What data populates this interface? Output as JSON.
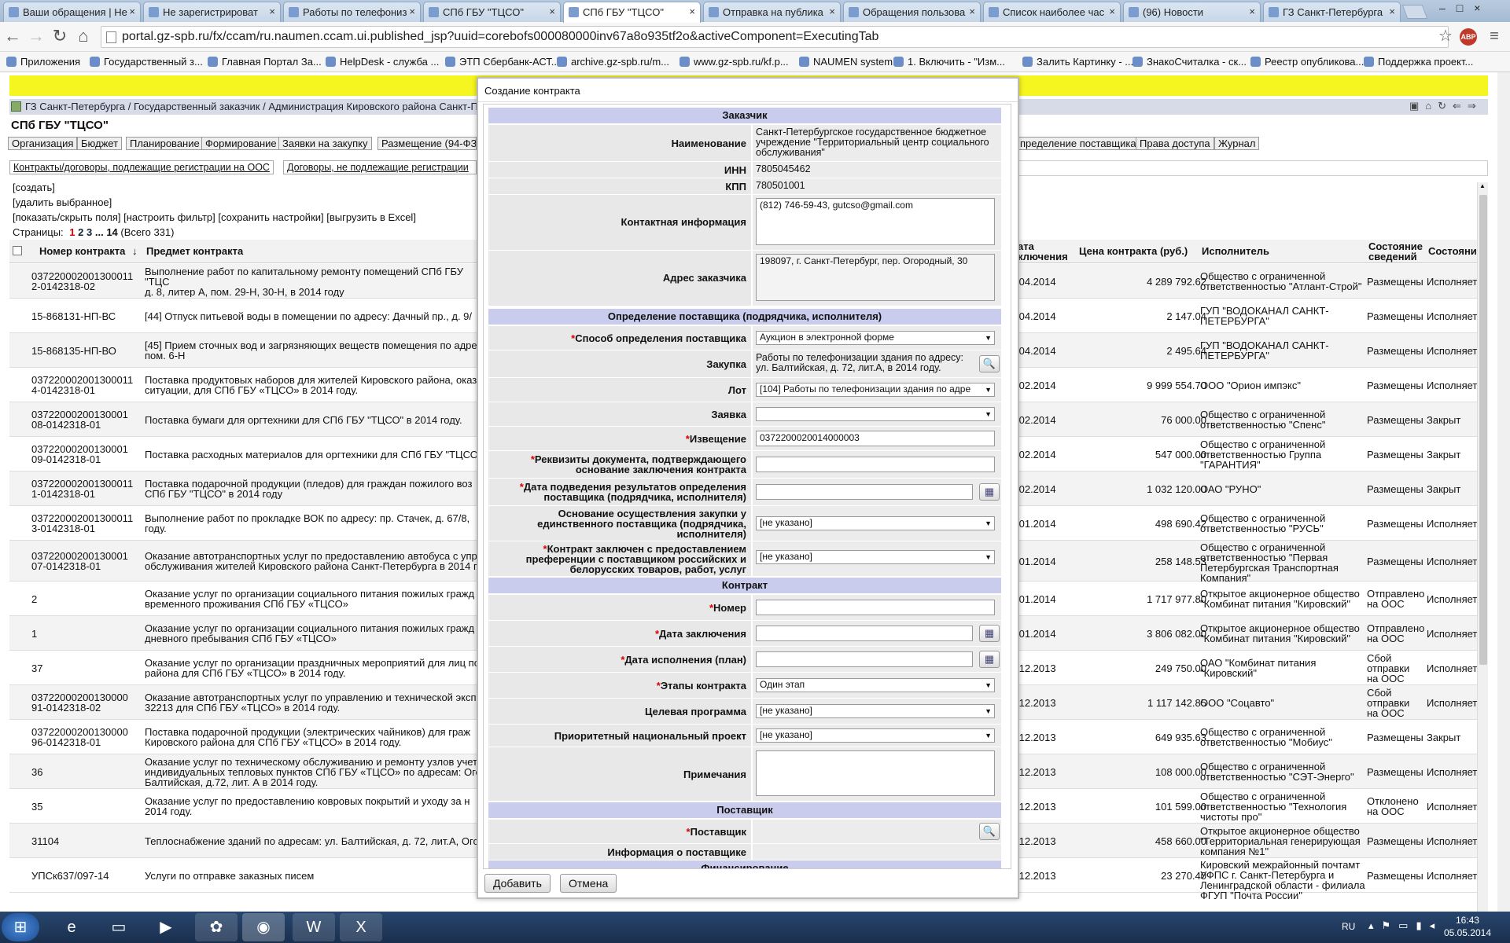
{
  "browser": {
    "tabs": [
      {
        "label": "Ваши обращения | Не"
      },
      {
        "label": "Не зарегистрироват"
      },
      {
        "label": "Работы по телефониз"
      },
      {
        "label": "СПб ГБУ \"ТЦСО\""
      },
      {
        "label": "СПб ГБУ \"ТЦСО\"",
        "active": true
      },
      {
        "label": "Отправка на публика"
      },
      {
        "label": "Обращения пользова"
      },
      {
        "label": "Список наиболее час"
      },
      {
        "label": "(96) Новости"
      },
      {
        "label": "ГЗ Санкт-Петербурга"
      }
    ],
    "url": "portal.gz-spb.ru/fx/ccam/ru.naumen.ccam.ui.published_jsp?uuid=corebofs000080000inv67a8o935tf2o&activeComponent=ExecutingTab",
    "ext_badge": "ABP",
    "bookmarks": [
      "Приложения",
      "Государственный з...",
      "Главная Портал За...",
      "HelpDesk - служба ...",
      "ЭТП Сбербанк-АСТ...",
      "archive.gz-spb.ru/m...",
      "www.gz-spb.ru/kf.p...",
      "NAUMEN system",
      "1. Включить - \"Изм...",
      "Залить Картинку - ...",
      "ЗнакоСчиталка - ск...",
      "Реестр опубликова...",
      "Поддержка проект..."
    ]
  },
  "page": {
    "breadcrumb": "ГЗ Санкт-Петербурга / Государственный заказчик / Администрация Кировского района Санкт-Пет",
    "org_title": "СПб ГБУ \"ТЦСО\"",
    "main_tabs": [
      "Организация",
      "Бюджет",
      "Планирование",
      "Формирование",
      "Заявки на закупку",
      "Размещение (94-ФЗ"
    ],
    "main_tabs_right": [
      "пределение поставщика",
      "Права доступа",
      "Журнал"
    ],
    "sub_tabs": [
      "Контракты/договоры, подлежащие регистрации на ООС",
      "Договоры, не подлежащие регистрации"
    ],
    "actions": {
      "create": "[создать]",
      "delete": "[удалить выбранное]",
      "show_hide": "[показать/скрыть поля]",
      "filter": "[настроить фильтр]",
      "save": "[сохранить настройки]",
      "export": "[выгрузить в Excel]"
    },
    "pager": {
      "label": "Страницы:",
      "current": "1",
      "p2": "2",
      "p3": "3",
      "dots": "...",
      "last": "14",
      "total": "(Всего 331)"
    },
    "columns": {
      "number": "Номер контракта",
      "subject": "Предмет контракта",
      "date": "ата\nключения",
      "price": "Цена контракта (руб.)",
      "executor": "Исполнитель",
      "info_state": "Состояние\nсведений",
      "state": "Состояние"
    },
    "rows": [
      {
        "number": "0372200020013000112-0142318-02",
        "subject": "Выполнение работ по капитальному ремонту помещений СПб ГБУ \"ТЦС\nд. 8, литер А, пом. 29-Н, 30-Н, в 2014 году",
        "date": ".04.2014",
        "price": "4 289 792.62",
        "executor": "Общество с ограниченной\nответственностью \"Атлант-Строй\"",
        "info": "Размещены",
        "state": "Исполняется"
      },
      {
        "number": "15-868131-НП-ВС",
        "subject": "[44] Отпуск питьевой воды в помещении по адресу: Дачный пр., д. 9/",
        "date": ".04.2014",
        "price": "2 147.04",
        "executor": "ГУП \"ВОДОКАНАЛ САНКТ-\nПЕТЕРБУРГА\"",
        "info": "Размещены",
        "state": "Исполняется"
      },
      {
        "number": "15-868135-НП-ВО",
        "subject": "[45] Прием сточных вод и загрязняющих веществ помещения по адре\nпом. 6-Н",
        "date": ".04.2014",
        "price": "2 495.64",
        "executor": "ГУП \"ВОДОКАНАЛ САНКТ-\nПЕТЕРБУРГА\"",
        "info": "Размещены",
        "state": "Исполняется"
      },
      {
        "number": "0372200020013000114-0142318-01",
        "subject": "Поставка продуктовых наборов для жителей Кировского района, оказ\nситуации, для СПб ГБУ «ТЦСО» в 2014 году.",
        "date": ".02.2014",
        "price": "9 999 554.70",
        "executor": "ООО \"Орион импэкс\"",
        "info": "Размещены",
        "state": "Исполняется"
      },
      {
        "number": "0372200020013000108-0142318-01",
        "subject": "Поставка бумаги для оргтехники для СПб ГБУ \"ТЦСО\" в 2014 году.",
        "date": ".02.2014",
        "price": "76 000.00",
        "executor": "Общество с ограниченной\nответственностью \"Спенс\"",
        "info": "Размещены",
        "state": "Закрыт"
      },
      {
        "number": "0372200020013000109-0142318-01",
        "subject": "Поставка расходных материалов для оргтехники для СПб ГБУ \"ТЦСО\"",
        "date": ".02.2014",
        "price": "547 000.00",
        "executor": "Общество с ограниченной\nответственностью Группа\n\"ГАРАНТИЯ\"",
        "info": "Размещены",
        "state": "Закрыт"
      },
      {
        "number": "0372200020013000111-0142318-01",
        "subject": "Поставка подарочной продукции (пледов) для граждан пожилого воз\nСПб ГБУ \"ТЦСО\" в 2014 году",
        "date": ".02.2014",
        "price": "1 032 120.00",
        "executor": "ОАО \"РУНО\"",
        "info": "Размещены",
        "state": "Закрыт"
      },
      {
        "number": "0372200020013000113-0142318-01",
        "subject": "Выполнение работ по прокладке ВОК по адресу: пр. Стачек, д. 67/8,\nгоду.",
        "date": ".01.2014",
        "price": "498 690.42",
        "executor": "Общество с ограниченной\nответственностью \"РУСЬ\"",
        "info": "Размещены",
        "state": "Исполняется"
      },
      {
        "number": "0372200020013000107-0142318-01",
        "subject": "Оказание автотранспортных услуг по предоставлению автобуса с упр\nобслуживания жителей Кировского района Санкт-Петербурга в 2014 г",
        "date": ".01.2014",
        "price": "258 148.53",
        "executor": "Общество с ограниченной\nответственностью \"Первая\nПетербургская Транспортная\nКомпания\"",
        "info": "Размещены",
        "state": "Исполняется"
      },
      {
        "number": "2",
        "subject": "Оказание услуг по организации социального питания пожилых гражд\nвременного проживания СПб ГБУ «ТЦСО»",
        "date": ".01.2014",
        "price": "1 717 977.80",
        "executor": "Открытое акционерное общество\n\"Комбинат питания \"Кировский\"",
        "info": "Отправлено\nна ООС",
        "state": "Исполняется"
      },
      {
        "number": "1",
        "subject": "Оказание услуг по организации социального питания пожилых гражд\nдневного пребывания СПб ГБУ «ТЦСО»",
        "date": ".01.2014",
        "price": "3 806 082.00",
        "executor": "Открытое акционерное общество\n\"Комбинат питания \"Кировский\"",
        "info": "Отправлено\nна ООС",
        "state": "Исполняется"
      },
      {
        "number": "37",
        "subject": "Оказание услуг по организации праздничных мероприятий для лиц по\nрайона для СПб ГБУ «ТЦСО» в 2014 году.",
        "date": ".12.2013",
        "price": "249 750.00",
        "executor": "ОАО \"Комбинат питания\n\"Кировский\"",
        "info": "Сбой\nотправки\nна ООС",
        "state": "Исполняется"
      },
      {
        "number": "0372200020013000091-0142318-02",
        "subject": "Оказание автотранспортных услуг по управлению и технической эксп\n32213 для СПб ГБУ «ТЦСО» в 2014 году.",
        "date": ".12.2013",
        "price": "1 117 142.85",
        "executor": "ООО \"Соцавто\"",
        "info": "Сбой\nотправки\nна ООС",
        "state": "Исполняется"
      },
      {
        "number": "0372200020013000096-0142318-01",
        "subject": "Поставка подарочной продукции (электрических чайников) для граж\nКировского района для СПб ГБУ «ТЦСО» в 2014 году.",
        "date": ".12.2013",
        "price": "649 935.63",
        "executor": "Общество с ограниченной\nответственностью \"Мобиус\"",
        "info": "Размещены",
        "state": "Закрыт"
      },
      {
        "number": "36",
        "subject": "Оказание услуг по техническому обслуживанию и ремонту узлов учет\nиндивидуальных тепловых пунктов СПб ГБУ «ТЦСО» по адресам: Ого\nБалтийская, д.72, лит. А в 2014 году.",
        "date": ".12.2013",
        "price": "108 000.00",
        "executor": "Общество с ограниченной\nответственностью \"СЭТ-Энерго\"",
        "info": "Размещены",
        "state": "Исполняется"
      },
      {
        "number": "35",
        "subject": "Оказание услуг по предоставлению ковровых покрытий и уходу за н\n2014 году.",
        "date": ".12.2013",
        "price": "101 599.00",
        "executor": "Общество с ограниченной\nответственностью \"Технология\nчистоты про\"",
        "info": "Отклонено\nна ООС",
        "state": "Исполняется"
      },
      {
        "number": "31104",
        "subject": "Теплоснабжение зданий по адресам: ул. Балтийская, д. 72, лит.А, Ого",
        "date": ".12.2013",
        "price": "458 660.00",
        "executor": "Открытое акционерное общество\n\"Территориальная генерирующая\nкомпания №1\"",
        "info": "Размещены",
        "state": "Исполняется"
      },
      {
        "number": "УПСк637/097-14",
        "subject": "Услуги по отправке заказных писем",
        "date": ".12.2013",
        "price": "23 270.40",
        "executor": "Кировский межрайонный почтамт\nУФПС г. Санкт-Петербурга и\nЛенинградской области - филиала\nФГУП \"Почта России\"",
        "info": "Размещены",
        "state": "Исполняется"
      }
    ]
  },
  "modal": {
    "title": "Создание контракта",
    "sec_customer": "Заказчик",
    "f_name_label": "Наименование",
    "f_name_value": "Санкт-Петербургское государственное бюджетное учреждение \"Территориальный центр социального обслуживания\"",
    "f_inn_label": "ИНН",
    "f_inn_value": "7805045462",
    "f_kpp_label": "КПП",
    "f_kpp_value": "780501001",
    "f_contact_label": "Контактная информация",
    "f_contact_value": "(812) 746-59-43, gutcso@gmail.com",
    "f_address_label": "Адрес заказчика",
    "f_address_value": "198097, г. Санкт-Петербург, пер. Огородный, 30",
    "sec_supplier_def": "Определение поставщика (подрядчика, исполнителя)",
    "f_method_label": "Способ определения поставщика",
    "f_method_value": "Аукцион в электронной форме",
    "f_purchase_label": "Закупка",
    "f_purchase_value": "Работы по телефонизации здания по адресу: ул. Балтийская, д. 72, лит.А, в 2014 году.",
    "f_lot_label": "Лот",
    "f_lot_value": "[104] Работы по телефонизации здания по адре",
    "f_bid_label": "Заявка",
    "f_bid_value": "",
    "f_notice_label": "Извещение",
    "f_notice_value": "0372200020014000003",
    "f_doc_label": "Реквизиты документа, подтверждающего основание заключения контракта",
    "f_doc_value": "",
    "f_resdate_label": "Дата подведения результатов определения поставщика (подрядчика, исполнителя)",
    "f_resdate_value": "",
    "f_single_label": "Основание осуществления закупки у единственного поставщика (подрядчика, исполнителя)",
    "f_single_value": "[не указано]",
    "f_pref_label": "Контракт заключен с предоставлением преференции с поставщиком российских и белорусских товаров, работ, услуг",
    "f_pref_value": "[не указано]",
    "sec_contract": "Контракт",
    "f_number_label": "Номер",
    "f_number_value": "",
    "f_concl_label": "Дата заключения",
    "f_concl_value": "",
    "f_exec_label": "Дата исполнения (план)",
    "f_exec_value": "",
    "f_stages_label": "Этапы контракта",
    "f_stages_value": "Один этап",
    "f_program_label": "Целевая программа",
    "f_program_value": "[не указано]",
    "f_national_label": "Приоритетный национальный проект",
    "f_national_value": "[не указано]",
    "f_notes_label": "Примечания",
    "f_notes_value": "",
    "sec_supplier": "Поставщик",
    "f_supplier_label": "Поставщик",
    "f_supplierinfo_label": "Информация о поставщике",
    "sec_finance": "Финансирование",
    "add_button": "Добавить",
    "cancel_button": "Отмена",
    "req_mark": "*"
  },
  "taskbar": {
    "lang": "RU",
    "time": "16:43",
    "date": "05.05.2014"
  }
}
